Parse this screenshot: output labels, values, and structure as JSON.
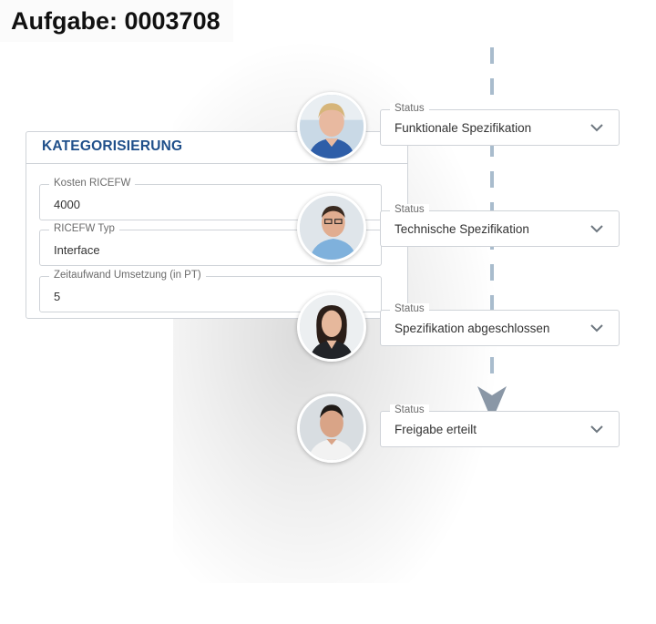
{
  "task": {
    "title": "Aufgabe: 0003708"
  },
  "categorization": {
    "heading": "KATEGORISIERUNG",
    "fields": [
      {
        "label": "Kosten RICEFW",
        "value": "4000"
      },
      {
        "label": "RICEFW Typ",
        "value": "Interface"
      },
      {
        "label": "Zeitaufwand Umsetzung (in PT)",
        "value": "5"
      }
    ]
  },
  "workflow": {
    "steps": [
      {
        "status_label": "Status",
        "status_value": "Funktionale Spezifikation",
        "icon": "chevron-down-icon"
      },
      {
        "status_label": "Status",
        "status_value": "Technische Spezifikation",
        "icon": "chevron-down-icon"
      },
      {
        "status_label": "Status",
        "status_value": "Spezifikation abgeschlossen",
        "icon": "chevron-down-icon"
      },
      {
        "status_label": "Status",
        "status_value": "Freigabe erteilt",
        "icon": "chevron-down-icon"
      }
    ]
  },
  "colors": {
    "heading": "#1f4f8a",
    "flow_line": "#a9bccd",
    "arrow": "#8a97a6",
    "border": "#cfd3d8"
  }
}
